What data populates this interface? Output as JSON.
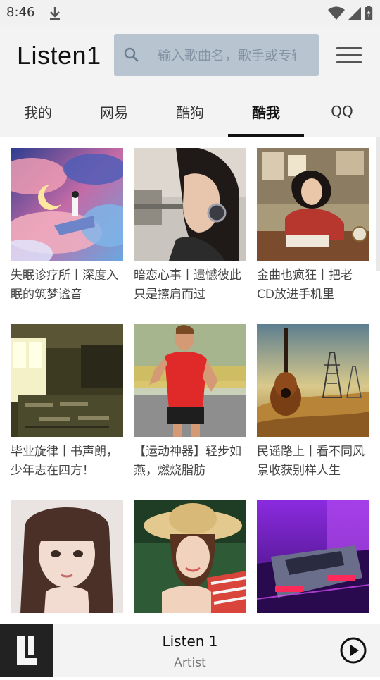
{
  "status": {
    "time": "8:46"
  },
  "app": {
    "title": "Listen1"
  },
  "search": {
    "placeholder": "输入歌曲名，歌手或专辑"
  },
  "tabs": [
    {
      "label": "我的",
      "active": false
    },
    {
      "label": "网易",
      "active": false
    },
    {
      "label": "酷狗",
      "active": false
    },
    {
      "label": "酷我",
      "active": true
    },
    {
      "label": "QQ",
      "active": false
    }
  ],
  "playlists": [
    {
      "title": "失眠诊疗所丨深度入眠的筑梦谧音",
      "art": "moon-dream-clouds"
    },
    {
      "title": "暗恋心事丨遗憾彼此只是擦肩而过",
      "art": "girl-headphones"
    },
    {
      "title": "金曲也疯狂丨把老CD放进手机里",
      "art": "woman-retro-desk"
    },
    {
      "title": "毕业旋律丨书声朗，少年志在四方！",
      "art": "empty-classroom"
    },
    {
      "title": "【运动神器】轻步如燕，燃烧脂肪",
      "art": "man-running"
    },
    {
      "title": "民谣路上丨看不同风景收获别样人生",
      "art": "guitar-sunset-pylons"
    },
    {
      "title": "",
      "art": "girl-portrait"
    },
    {
      "title": "",
      "art": "girl-straw-hat"
    },
    {
      "title": "",
      "art": "neon-car"
    }
  ],
  "player": {
    "title": "Listen 1",
    "artist": "Artist"
  }
}
